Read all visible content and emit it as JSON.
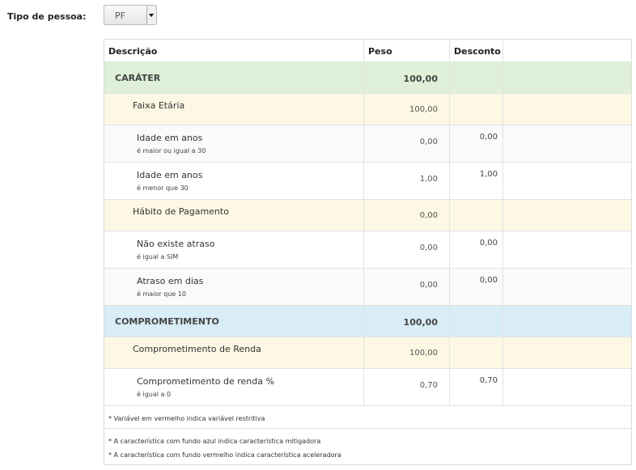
{
  "filter": {
    "label": "Tipo de pessoa:",
    "value": "PF"
  },
  "table": {
    "headers": {
      "descricao": "Descrição",
      "peso": "Peso",
      "desconto": "Desconto"
    },
    "rows": [
      {
        "kind": "group",
        "name": "CARÁTER",
        "weight": "100,00"
      },
      {
        "kind": "sub",
        "name": "Faixa Etária",
        "weight": "100,00"
      },
      {
        "kind": "item",
        "name": "Idade em anos",
        "cond": "é maior ou igual a 30",
        "weight": "0,00",
        "discount": "0,00"
      },
      {
        "kind": "item",
        "name": "Idade em anos",
        "cond": "é menor que 30",
        "weight": "1,00",
        "discount": "1,00"
      },
      {
        "kind": "sub",
        "name": "Hábito de Pagamento",
        "weight": "0,00"
      },
      {
        "kind": "item",
        "name": "Não existe atraso",
        "cond": "é igual a SIM",
        "weight": "0,00",
        "discount": "0,00"
      },
      {
        "kind": "item",
        "name": "Atraso em dias",
        "cond": "é maior que 10",
        "weight": "0,00",
        "discount": "0,00"
      },
      {
        "kind": "group",
        "name": "COMPROMETIMENTO",
        "weight": "100,00"
      },
      {
        "kind": "sub",
        "name": "Comprometimento de Renda",
        "weight": "100,00"
      },
      {
        "kind": "item",
        "name": "Comprometimento de renda %",
        "cond": "é igual a 0",
        "weight": "0,70",
        "discount": "0,70"
      }
    ]
  },
  "notes": {
    "restrictive": "* Variável em vermelho indica variável restritiva",
    "mitigating": "* A característica com fundo azul indica característica mitigadora",
    "accelerating": "* A característica com fundo vermelho indica característica aceleradora"
  },
  "colors": {
    "caracter_group_bg": "#dff0d8",
    "comprometimento_group_bg": "#d9edf7",
    "subgroup_bg": "#fcf8e3"
  }
}
